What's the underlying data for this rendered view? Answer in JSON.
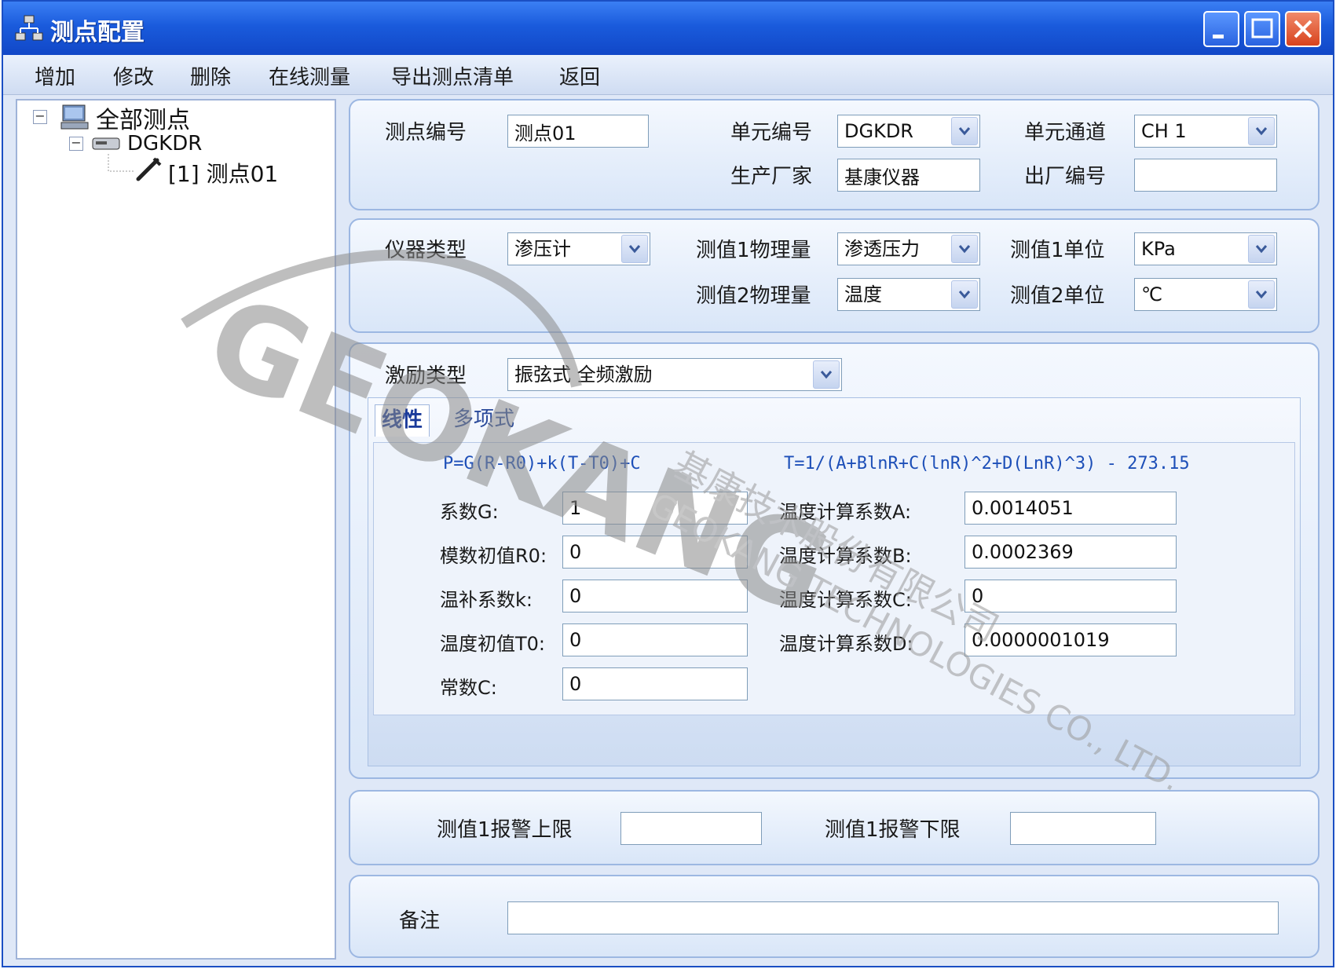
{
  "window": {
    "title": "测点配置"
  },
  "menu": [
    "增加",
    "修改",
    "删除",
    "在线测量",
    "导出测点清单",
    "返回"
  ],
  "tree": {
    "root": "全部测点",
    "unit": "DGKDR",
    "point": "[1] 测点01"
  },
  "basic": {
    "point_id_label": "测点编号",
    "point_id": "测点01",
    "unit_id_label": "单元编号",
    "unit_id": "DGKDR",
    "channel_label": "单元通道",
    "channel": "CH 1",
    "maker_label": "生产厂家",
    "maker": "基康仪器",
    "serial_label": "出厂编号",
    "serial": ""
  },
  "instrument": {
    "type_label": "仪器类型",
    "type": "渗压计",
    "m1_qty_label": "测值1物理量",
    "m1_qty": "渗透压力",
    "m1_unit_label": "测值1单位",
    "m1_unit": "KPa",
    "m2_qty_label": "测值2物理量",
    "m2_qty": "温度",
    "m2_unit_label": "测值2单位",
    "m2_unit": "℃"
  },
  "excitation": {
    "label": "激励类型",
    "value": "振弦式 全频激励",
    "tabs": [
      "线性",
      "多项式"
    ],
    "linear": {
      "formula": "P=G(R-R0)+k(T-T0)+C",
      "G_label": "系数G:",
      "G": "1",
      "R0_label": "模数初值R0:",
      "R0": "0",
      "k_label": "温补系数k:",
      "k": "0",
      "T0_label": "温度初值T0:",
      "T0": "0",
      "C_label": "常数C:",
      "C": "0"
    },
    "temp": {
      "formula": "T=1/(A+BlnR+C(lnR)^2+D(LnR)^3) - 273.15",
      "A_label": "温度计算系数A:",
      "A": "0.0014051",
      "B_label": "温度计算系数B:",
      "B": "0.0002369",
      "C_label": "温度计算系数C:",
      "C": "0",
      "D_label": "温度计算系数D:",
      "D": "0.0000001019"
    }
  },
  "alarm": {
    "upper_label": "测值1报警上限",
    "upper": "",
    "lower_label": "测值1报警下限",
    "lower": ""
  },
  "remark": {
    "label": "备注",
    "value": ""
  },
  "watermark": {
    "brand": "GEOKANG",
    "cn": "基康技术股份有限公司",
    "en": "GEOKANG TECHNOLOGIES CO., LTD."
  },
  "colors": {
    "title_bar": "#1a5bdc",
    "panel_border": "#9cb7e2",
    "formula_blue": "#1d4fb8"
  }
}
